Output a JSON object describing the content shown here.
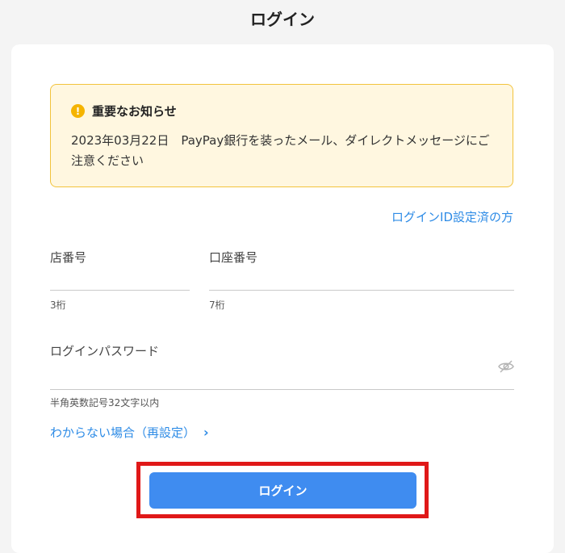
{
  "header": {
    "title": "ログイン"
  },
  "notice": {
    "title": "重要なお知らせ",
    "body": "2023年03月22日　PayPay銀行を装ったメール、ダイレクトメッセージにご注意ください"
  },
  "login_id_link": "ログインID設定済の方",
  "form": {
    "branch": {
      "label": "店番号",
      "hint": "3桁",
      "value": ""
    },
    "account": {
      "label": "口座番号",
      "hint": "7桁",
      "value": ""
    },
    "password": {
      "label": "ログインパスワード",
      "hint": "半角英数記号32文字以内",
      "value": ""
    }
  },
  "help_link": {
    "label": "わからない場合（再設定）",
    "icon": "chevron-right-icon"
  },
  "submit_button": {
    "label": "ログイン"
  },
  "colors": {
    "accent": "#3f8cf0",
    "link": "#2d8be6",
    "notice_bg": "#fff7e0",
    "notice_border": "#f2c33c",
    "highlight": "#e01818"
  }
}
